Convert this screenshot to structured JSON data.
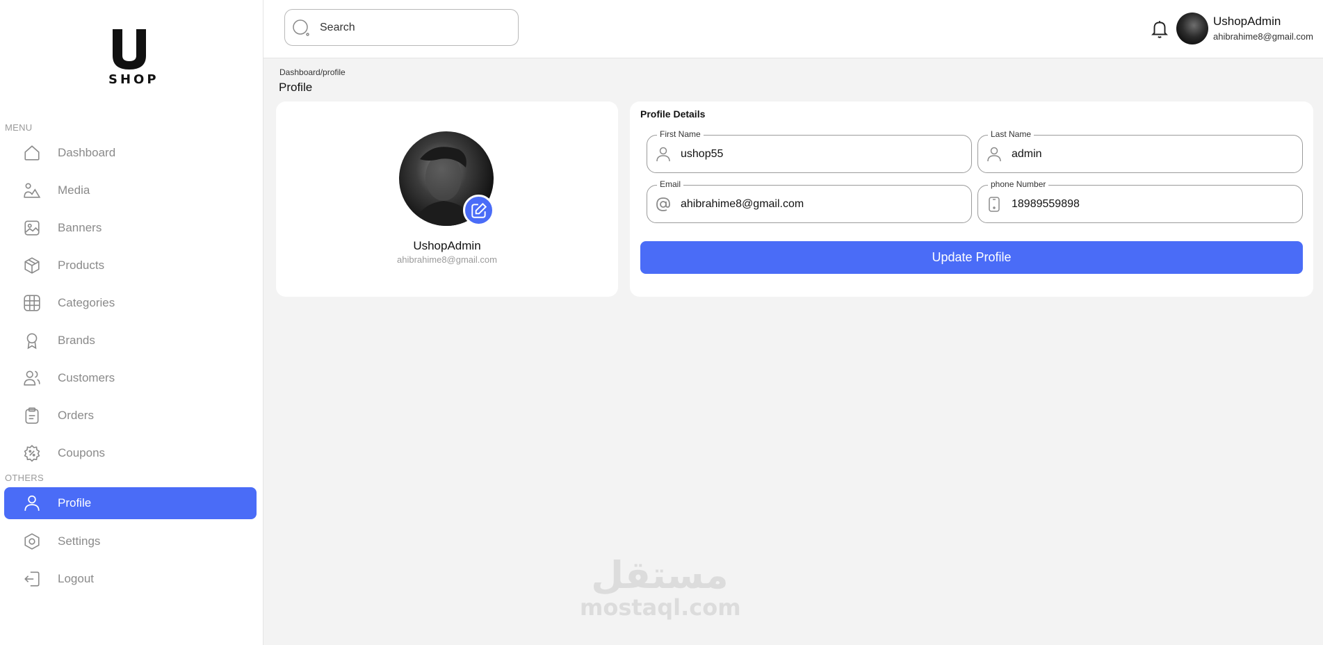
{
  "brand": {
    "logo_letter": "U",
    "logo_text": "SHOP"
  },
  "sidebar": {
    "menu_label": "MENU",
    "others_label": "OTHERS",
    "items": [
      {
        "label": "Dashboard",
        "icon": "home-icon"
      },
      {
        "label": "Media",
        "icon": "media-icon"
      },
      {
        "label": "Banners",
        "icon": "image-icon"
      },
      {
        "label": "Products",
        "icon": "box-icon"
      },
      {
        "label": "Categories",
        "icon": "grid-icon"
      },
      {
        "label": "Brands",
        "icon": "award-icon"
      },
      {
        "label": "Customers",
        "icon": "users-icon"
      },
      {
        "label": "Orders",
        "icon": "clipboard-icon"
      },
      {
        "label": "Coupons",
        "icon": "coupon-icon"
      }
    ],
    "others": [
      {
        "label": "Profile",
        "icon": "user-icon",
        "active": true
      },
      {
        "label": "Settings",
        "icon": "settings-icon"
      },
      {
        "label": "Logout",
        "icon": "logout-icon"
      }
    ]
  },
  "header": {
    "search_placeholder": "Search",
    "user_name": "UshopAdmin",
    "user_email": "ahibrahime8@gmail.com"
  },
  "breadcrumb": "Dashboard/profile",
  "page_title": "Profile",
  "profile_card": {
    "name": "UshopAdmin",
    "email": "ahibrahime8@gmail.com"
  },
  "details": {
    "title": "Profile Details",
    "first_name_label": "First Name",
    "first_name_value": "ushop55",
    "last_name_label": "Last Name",
    "last_name_value": "admin",
    "email_label": "Email",
    "email_value": "ahibrahime8@gmail.com",
    "phone_label": "phone Number",
    "phone_value": "18989559898",
    "update_button": "Update Profile"
  },
  "watermark": {
    "arabic": "مستقل",
    "latin": "mostaql.com"
  },
  "colors": {
    "accent": "#4a6cf7",
    "background": "#f3f3f3"
  }
}
